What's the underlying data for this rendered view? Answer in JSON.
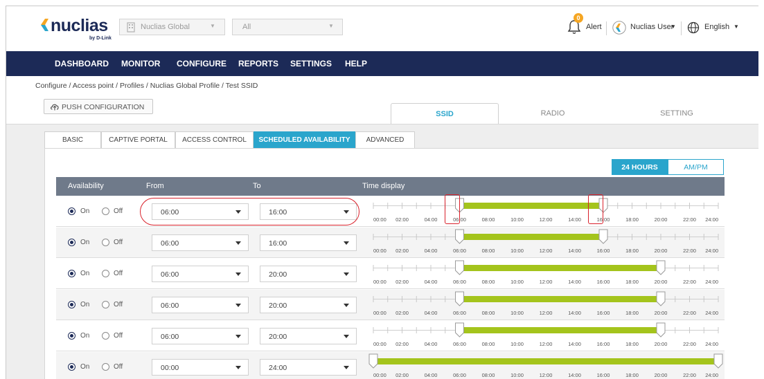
{
  "header": {
    "logo_text": "nuclias",
    "logo_sub": "by D-Link",
    "org_select": "Nuclias Global",
    "site_select": "All",
    "alert_count": "0",
    "alert_label": "Alert",
    "user_label": "Nuclias User",
    "language_label": "English"
  },
  "nav": {
    "items": [
      "DASHBOARD",
      "MONITOR",
      "CONFIGURE",
      "REPORTS",
      "SETTINGS",
      "HELP"
    ]
  },
  "breadcrumb": "Configure / Access point / Profiles / Nuclias Global Profile / Test SSID",
  "push_button": "PUSH CONFIGURATION",
  "main_tabs": [
    "SSID",
    "RADIO",
    "SETTING"
  ],
  "sub_tabs": [
    "BASIC",
    "CAPTIVE PORTAL",
    "ACCESS CONTROL",
    "SCHEDULED AVAILABILITY",
    "ADVANCED"
  ],
  "format_toggle": [
    "24 HOURS",
    "AM/PM"
  ],
  "table": {
    "headers": [
      "Availability",
      "From",
      "To",
      "Time display"
    ],
    "on_label": "On",
    "off_label": "Off",
    "time_ticks": [
      "00:00",
      "02:00",
      "04:00",
      "06:00",
      "08:00",
      "10:00",
      "12:00",
      "14:00",
      "16:00",
      "18:00",
      "20:00",
      "22:00",
      "24:00"
    ],
    "rows": [
      {
        "availability": "On",
        "from": "06:00",
        "to": "16:00",
        "from_hour": 6,
        "to_hour": 16
      },
      {
        "availability": "On",
        "from": "06:00",
        "to": "16:00",
        "from_hour": 6,
        "to_hour": 16
      },
      {
        "availability": "On",
        "from": "06:00",
        "to": "20:00",
        "from_hour": 6,
        "to_hour": 20
      },
      {
        "availability": "On",
        "from": "06:00",
        "to": "20:00",
        "from_hour": 6,
        "to_hour": 20
      },
      {
        "availability": "On",
        "from": "06:00",
        "to": "20:00",
        "from_hour": 6,
        "to_hour": 20
      },
      {
        "availability": "On",
        "from": "00:00",
        "to": "24:00",
        "from_hour": 0,
        "to_hour": 24
      }
    ]
  },
  "colors": {
    "brand_navy": "#1c2a57",
    "accent_blue": "#2aa5cc",
    "bar_green": "#a4c41c",
    "highlight_red": "#d9202a",
    "alert_orange": "#f5a623"
  }
}
